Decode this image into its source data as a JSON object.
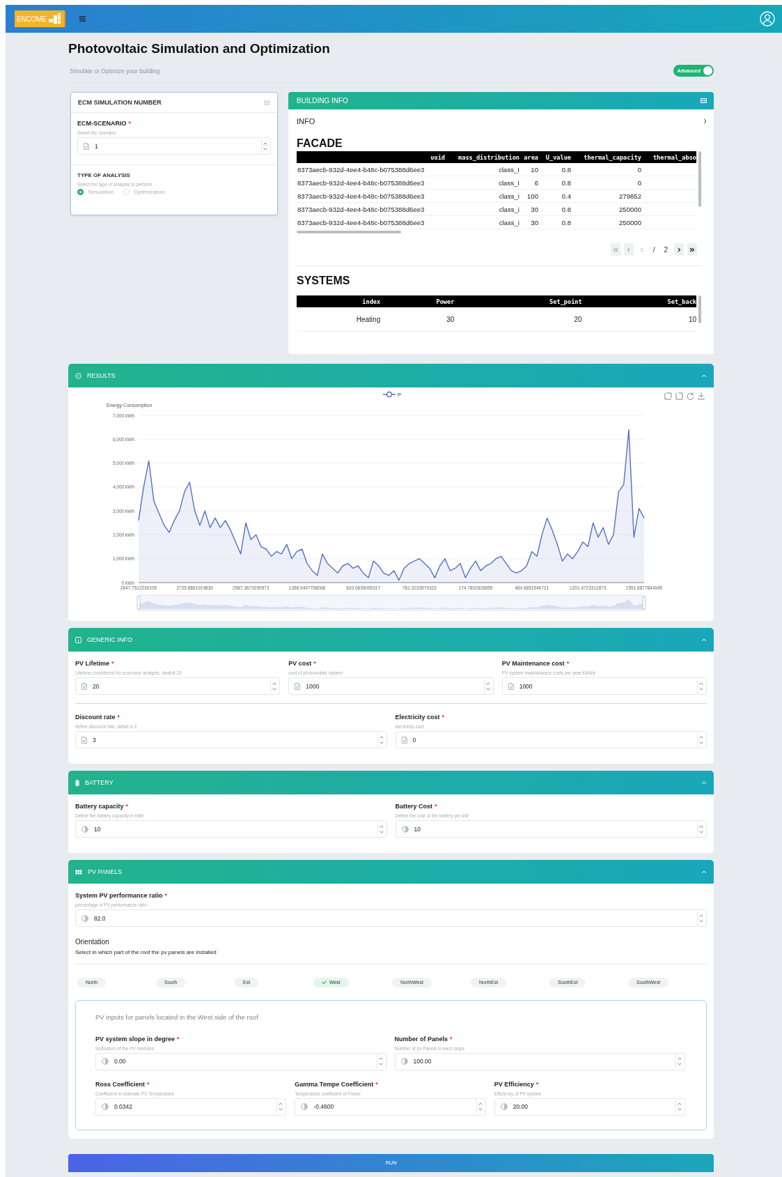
{
  "header": {
    "logo_text": "ENCOME"
  },
  "page": {
    "title": "Photovoltaic Simulation and Optimization",
    "subtitle": "Simulate or Optimize your building"
  },
  "toggle": {
    "label": "Advanced",
    "on": true
  },
  "ecm_card": {
    "title": "ECM SIMULATION NUMBER",
    "scenario": {
      "label": "ECM-SCENARIO",
      "mark": "*",
      "hint": "Select the scenario",
      "value": "1"
    },
    "analysis": {
      "title": "TYPE OF ANALYSIS",
      "hint": "Select the type of analysis to perform",
      "options": [
        {
          "label": "Simulation",
          "selected": true
        },
        {
          "label": "Optimization",
          "selected": false
        }
      ]
    }
  },
  "building_info": {
    "title": "BUILDING INFO",
    "info_row": "INFO",
    "facade_title": "FACADE",
    "facade_columns": [
      "uuid",
      "mass_distribution",
      "area",
      "U_value",
      "thermal_capacity",
      "thermal_abso"
    ],
    "facade_rows": [
      [
        "8373aecb-932d-4ee4-b48c-b075388d6ee3",
        "class_I",
        "10",
        "0.8",
        "0"
      ],
      [
        "8373aecb-932d-4ee4-b48c-b075388d6ee3",
        "class_I",
        "6",
        "0.8",
        "0"
      ],
      [
        "8373aecb-932d-4ee4-b48c-b075388d6ee3",
        "class_i",
        "100",
        "0.4",
        "279852"
      ],
      [
        "8373aecb-932d-4ee4-b48c-b075388d6ee3",
        "class_i",
        "30",
        "0.8",
        "250000"
      ],
      [
        "8373aecb-932d-4ee4-b48c-b075388d6ee3",
        "class_i",
        "30",
        "0.8",
        "250000"
      ]
    ],
    "pagination": {
      "page": "1",
      "separator": "/",
      "total": "2"
    },
    "systems_title": "SYSTEMS",
    "systems_columns": [
      "index",
      "Power",
      "Set_point",
      "Set_back"
    ],
    "systems_rows": [
      [
        "Heating",
        "30",
        "20",
        "10"
      ]
    ]
  },
  "results": {
    "title": "RESULTS",
    "chart_data": {
      "type": "area",
      "ylabel": "Energy Consumption",
      "grid": true,
      "ylim": [
        0,
        7000
      ],
      "yticks": [
        {
          "value": 0,
          "label": "0 kWh"
        },
        {
          "value": 1000,
          "label": "1,000 kWh"
        },
        {
          "value": 2000,
          "label": "2,000 kWh"
        },
        {
          "value": 3000,
          "label": "3,000 kWh"
        },
        {
          "value": 4000,
          "label": "4,000 kWh"
        },
        {
          "value": 5000,
          "label": "5,000 kWh"
        },
        {
          "value": 6000,
          "label": "6,000 kWh"
        },
        {
          "value": 7000,
          "label": "7,000 kWh"
        }
      ],
      "categories": [
        "2647.7512230105",
        null,
        null,
        null,
        null,
        null,
        null,
        null,
        null,
        null,
        null,
        "2725.8861919839",
        null,
        null,
        null,
        null,
        null,
        null,
        null,
        null,
        null,
        null,
        "2587.3679290573",
        null,
        null,
        null,
        null,
        null,
        null,
        null,
        null,
        null,
        null,
        "1288.9497798068",
        null,
        null,
        null,
        null,
        null,
        null,
        null,
        null,
        null,
        null,
        "620.0839095317",
        null,
        null,
        null,
        null,
        null,
        null,
        null,
        null,
        null,
        null,
        "781.3233579323",
        null,
        null,
        null,
        null,
        null,
        null,
        null,
        null,
        null,
        null,
        "174.7802626855",
        null,
        null,
        null,
        null,
        null,
        null,
        null,
        null,
        null,
        null,
        "484.6851546721",
        null,
        null,
        null,
        null,
        null,
        null,
        null,
        null,
        null,
        null,
        "1201.4723312873",
        null,
        null,
        null,
        null,
        null,
        null,
        null,
        null,
        null,
        null,
        "1551.6877844945"
      ],
      "series": [
        {
          "name": "P",
          "color": "#5470c6",
          "values": [
            2600,
            4000,
            5100,
            3400,
            2900,
            2400,
            2100,
            2600,
            3000,
            3800,
            4200,
            3000,
            2400,
            3000,
            2300,
            2700,
            2300,
            2600,
            2200,
            1700,
            1200,
            2500,
            1800,
            2000,
            1500,
            1400,
            1100,
            1300,
            1200,
            1600,
            1000,
            1300,
            1400,
            800,
            500,
            300,
            1200,
            800,
            600,
            400,
            700,
            800,
            600,
            700,
            400,
            200,
            900,
            700,
            400,
            300,
            500,
            100,
            600,
            800,
            900,
            1000,
            800,
            600,
            200,
            700,
            1000,
            500,
            600,
            800,
            200,
            600,
            900,
            500,
            700,
            800,
            1000,
            1100,
            800,
            500,
            400,
            500,
            700,
            1300,
            1100,
            2000,
            2700,
            2200,
            1600,
            900,
            1200,
            1000,
            1300,
            1700,
            1500,
            2500,
            1900,
            2300,
            1600,
            2000,
            3800,
            4100,
            6400,
            1900,
            3100,
            2700
          ]
        }
      ]
    }
  },
  "generic_info": {
    "title": "GENERIC INFO",
    "rows": [
      [
        {
          "label": "PV Lifetime",
          "mark": "*",
          "hint": "Lifetime considered for economic analysis, deafult 20",
          "value": "20"
        },
        {
          "label": "PV cost",
          "mark": "*",
          "hint": "cost of photovoltaic system",
          "value": "1000"
        },
        {
          "label": "PV Maintenance cost",
          "mark": "*",
          "hint": "PV system maintainance costs per year €/kWp",
          "value": "1000"
        }
      ],
      [
        {
          "label": "Discount rate",
          "mark": "*",
          "hint": "define discount rate, dafult is 3",
          "value": "3"
        },
        {
          "label": "Electricity cost",
          "mark": "*",
          "hint": "electricity cost",
          "value": "0"
        }
      ]
    ]
  },
  "battery": {
    "title": "BATTERY",
    "rows": [
      [
        {
          "label": "Battery capacity",
          "mark": "*",
          "hint": "Define the battery capacity in kWh",
          "value": "10"
        },
        {
          "label": "Battery Cost",
          "mark": "*",
          "hint": "Define the cost of the battery per kW",
          "value": "10"
        }
      ]
    ]
  },
  "pv_panels": {
    "title": "PV PANELS",
    "ratio": {
      "label": "System PV performance ratio",
      "mark": "*",
      "hint": "percentage of PV performance ratio",
      "value": "82.0"
    },
    "orientation_title": "Orientation",
    "orientation_text": "Select in which part of the roof the pv panels are installed",
    "orientations": [
      {
        "label": "North",
        "selected": false
      },
      {
        "label": "South",
        "selected": false
      },
      {
        "label": "Est",
        "selected": false
      },
      {
        "label": "West",
        "selected": true
      },
      {
        "label": "NorthWest",
        "selected": false
      },
      {
        "label": "NorthEst",
        "selected": false
      },
      {
        "label": "SouthEst",
        "selected": false
      },
      {
        "label": "SouthWest",
        "selected": false
      }
    ],
    "inputs_text": "PV inputs for panels located in the West side of the roof",
    "rows": [
      [
        {
          "label": "PV system slope in degree",
          "mark": "*",
          "hint": "Inclination of the PV modules",
          "value": "0.00"
        },
        {
          "label": "Number of Panels",
          "mark": "*",
          "hint": "Number of pv Panels in each slope",
          "value": "100.00"
        }
      ],
      [
        {
          "label": "Ross Coefficient",
          "mark": "*",
          "hint": "Coefficient to estimate PV Temperature",
          "value": "0.0342"
        },
        {
          "label": "Gamma Tempe Coefficient",
          "mark": "*",
          "hint": "Temperature coefficient of Power",
          "value": "-0.4600"
        },
        {
          "label": "PV Efficiency",
          "mark": "*",
          "hint": "Efficiency of PV system",
          "value": "20.00"
        }
      ]
    ]
  },
  "run_button": "RUN"
}
